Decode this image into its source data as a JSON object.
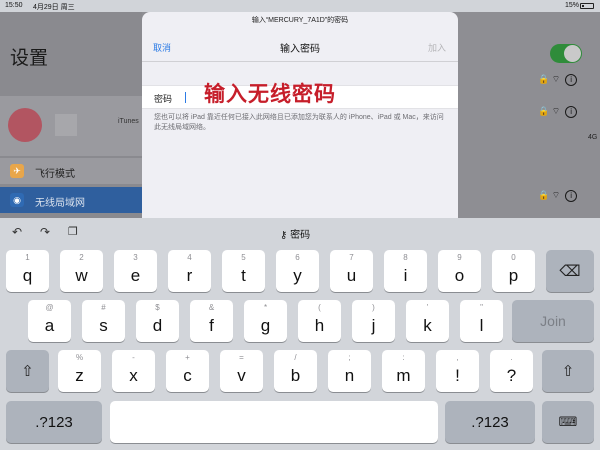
{
  "status_bar": {
    "time": "15:50",
    "date": "4月29日 周三",
    "battery": "15%"
  },
  "settings_bg": {
    "title": "设置",
    "profile_text": "iTunes",
    "items": [
      {
        "label": "飞行模式",
        "icon": "airplane-icon",
        "color": "#e8a64a"
      },
      {
        "label": "无线局域网",
        "icon": "wifi-icon",
        "color": "#2f6ab3",
        "selected": true
      }
    ],
    "cellular": "4G"
  },
  "modal": {
    "subtitle": "输入“MERCURY_7A1D”的密码",
    "cancel": "取消",
    "title": "输入密码",
    "join": "加入",
    "password_label": "密码",
    "password_value": "",
    "annotation": "输入无线密码",
    "note": "您也可以将 iPad 靠近任何已接入此网络且已添加您为联系人的 iPhone、iPad 或 Mac，来访问此无线局域网络。"
  },
  "keyboard": {
    "toolbar": {
      "center_label": "密码",
      "undo_icon": "undo-icon",
      "redo_icon": "redo-icon",
      "clipboard_icon": "clipboard-icon"
    },
    "row1": [
      {
        "pri": "q",
        "sec": "1"
      },
      {
        "pri": "w",
        "sec": "2"
      },
      {
        "pri": "e",
        "sec": "3"
      },
      {
        "pri": "r",
        "sec": "4"
      },
      {
        "pri": "t",
        "sec": "5"
      },
      {
        "pri": "y",
        "sec": "6"
      },
      {
        "pri": "u",
        "sec": "7"
      },
      {
        "pri": "i",
        "sec": "8"
      },
      {
        "pri": "o",
        "sec": "9"
      },
      {
        "pri": "p",
        "sec": "0"
      }
    ],
    "row2": [
      {
        "pri": "a",
        "sec": "@"
      },
      {
        "pri": "s",
        "sec": "#"
      },
      {
        "pri": "d",
        "sec": "$"
      },
      {
        "pri": "f",
        "sec": "&"
      },
      {
        "pri": "g",
        "sec": "*"
      },
      {
        "pri": "h",
        "sec": "("
      },
      {
        "pri": "j",
        "sec": ")"
      },
      {
        "pri": "k",
        "sec": "'"
      },
      {
        "pri": "l",
        "sec": "\""
      }
    ],
    "row3": [
      {
        "pri": "z",
        "sec": "%"
      },
      {
        "pri": "x",
        "sec": "-"
      },
      {
        "pri": "c",
        "sec": "+"
      },
      {
        "pri": "v",
        "sec": "="
      },
      {
        "pri": "b",
        "sec": "/"
      },
      {
        "pri": "n",
        "sec": ";"
      },
      {
        "pri": "m",
        "sec": ":"
      },
      {
        "pri": "!",
        "sec": ","
      },
      {
        "pri": "?",
        "sec": "."
      }
    ],
    "join": "Join",
    "numbers": ".?123",
    "backspace_icon": "backspace-icon",
    "shift_icon": "shift-icon",
    "hide_keyboard_icon": "keyboard-icon"
  }
}
